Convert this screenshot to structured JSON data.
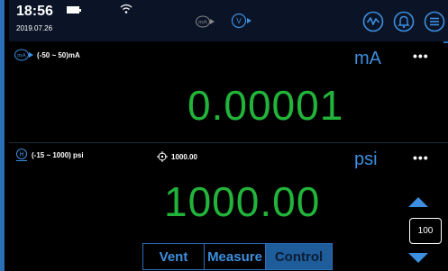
{
  "header": {
    "time": "18:56",
    "date": "2019.07.26",
    "icons": [
      "battery-icon",
      "wifi-icon",
      "mode-ma-icon",
      "mode-v-icon",
      "chart-icon",
      "bell-icon",
      "menu-icon"
    ]
  },
  "channel1": {
    "range": "(-50 ~ 50)mA",
    "unit": "mA",
    "reading": "0.00001",
    "more": "•••"
  },
  "channel2": {
    "range": "(-15 ~ 1000) psi",
    "target": "1000.00",
    "unit": "psi",
    "reading": "1000.00",
    "more": "•••",
    "step": "100"
  },
  "tabs": {
    "vent": "Vent",
    "measure": "Measure",
    "control": "Control",
    "active": "control"
  },
  "colors": {
    "accent": "#3d8fe0",
    "reading": "#22b43a",
    "frame": "#2a6fb8",
    "background": "#000000"
  }
}
